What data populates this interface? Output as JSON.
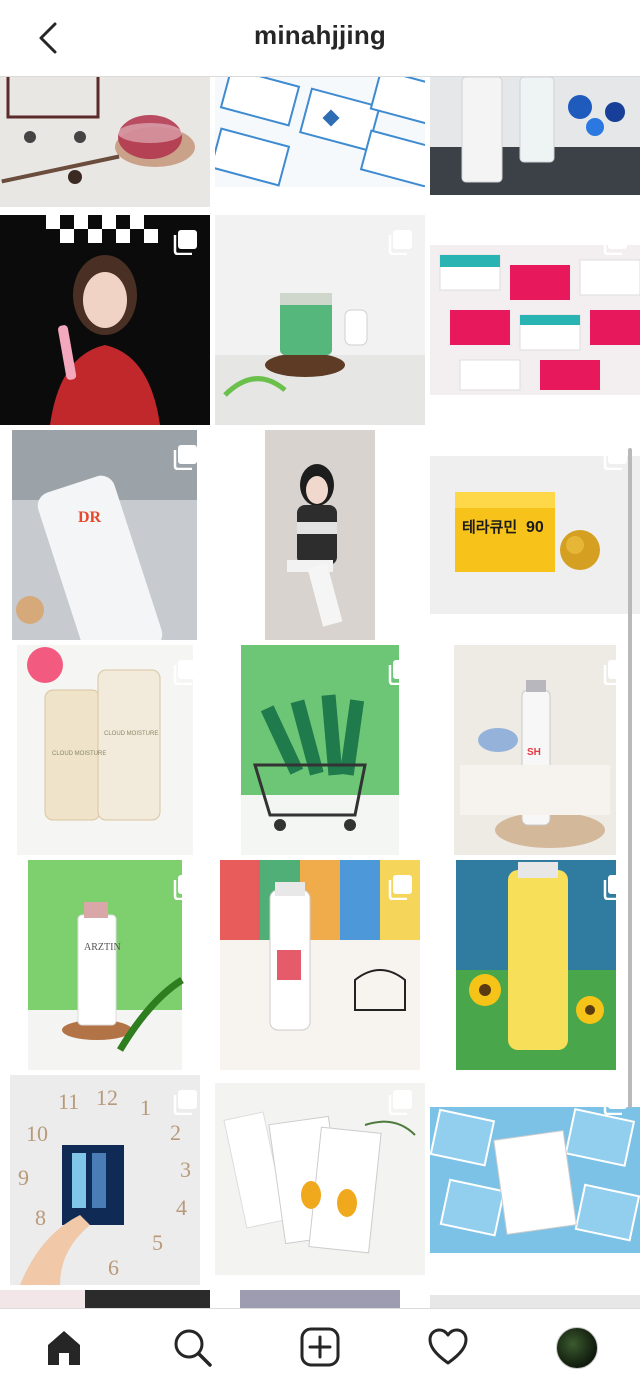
{
  "header": {
    "username": "minahjjing"
  },
  "icons": {
    "back": "chevron-left-icon",
    "multi": "carousel-multiple-icon",
    "home": "home-icon",
    "search": "search-icon",
    "new_post": "plus-square-icon",
    "activity": "heart-icon",
    "profile": "profile-avatar"
  },
  "posts": [
    {
      "id": "p1",
      "subject": "mini shopping cart and red tea cup",
      "bg": "#e8e6e3",
      "multi": false
    },
    {
      "id": "p2",
      "subject": "blue-bordered product cards",
      "bg": "#e9f2fa",
      "multi": false
    },
    {
      "id": "p3",
      "subject": "toner bottles with blue crystals",
      "bg": "#d7d9da",
      "multi": false
    },
    {
      "id": "p4",
      "subject": "woman with pink device, checkered backdrop",
      "bg": "#111111",
      "multi": true
    },
    {
      "id": "p5",
      "subject": "green CURE cream jar on wood slice",
      "bg": "#eef0ee",
      "multi": true
    },
    {
      "id": "p6",
      "subject": "pink and teal sheet mask packs",
      "bg": "#f2eff1",
      "multi": true
    },
    {
      "id": "p7",
      "subject": "DR tube cream on grey fabric",
      "bg": "#c9cdd0",
      "multi": true
    },
    {
      "id": "p8",
      "subject": "woman sitting on white stool",
      "bg": "#d6d3cf",
      "multi": true
    },
    {
      "id": "p9",
      "subject": "yellow supplement box with flower",
      "bg": "#eeeeef",
      "multi": true
    },
    {
      "id": "p10",
      "subject": "cloud moisture facial toner bottles",
      "bg": "#f4f4f4",
      "multi": true
    },
    {
      "id": "p11",
      "subject": "green sachets in shopping cart",
      "bg": "#6bc777",
      "multi": true
    },
    {
      "id": "p12",
      "subject": "SH pearl bubble essence bottle",
      "bg": "#efece6",
      "multi": true
    },
    {
      "id": "p13",
      "subject": "ARZTIN toner with palm leaf",
      "bg": "#7fcf70",
      "multi": true
    },
    {
      "id": "p14",
      "subject": "Tetraforce toner with mini chair",
      "bg": "#f0b36b",
      "multi": true
    },
    {
      "id": "p15",
      "subject": "yellow toner with sunflowers in cart",
      "bg": "#2d7c9e",
      "multi": true
    },
    {
      "id": "p16",
      "subject": "product box held in front of wall clock",
      "bg": "#ececec",
      "multi": true
    },
    {
      "id": "p17",
      "subject": "Zure sample sachets",
      "bg": "#f3f3f3",
      "multi": true
    },
    {
      "id": "p18",
      "subject": "blue sheet mask envelopes",
      "bg": "#7fc3e6",
      "multi": true
    }
  ],
  "clock": {
    "n12": "12",
    "n1": "1",
    "n2": "2",
    "n3": "3",
    "n4": "4",
    "n5": "5",
    "n6": "6",
    "n9": "9",
    "n10": "10",
    "n11": "11",
    "n8": "8"
  }
}
